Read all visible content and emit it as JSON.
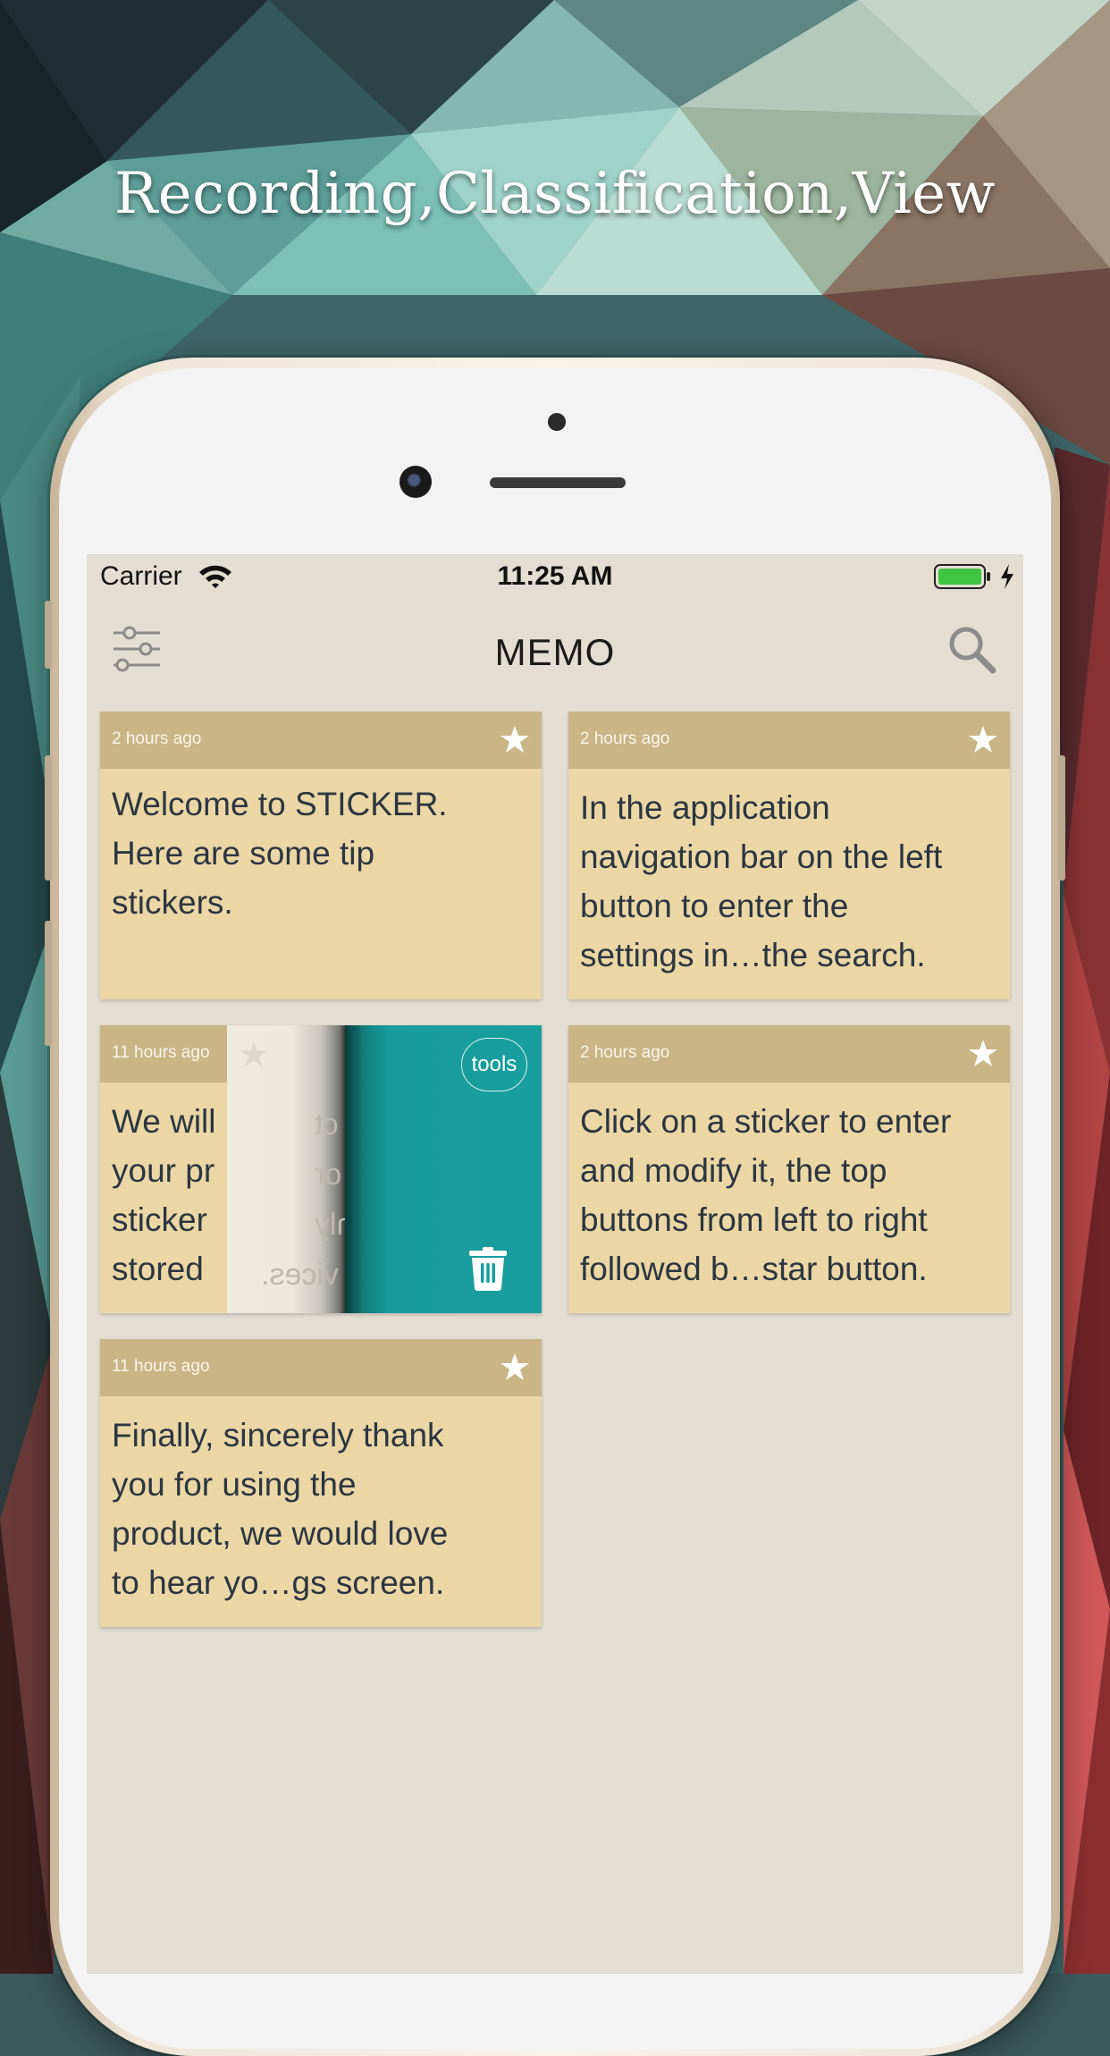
{
  "headline": "Recording,Classification,View",
  "status_bar": {
    "carrier": "Carrier",
    "time": "11:25 AM",
    "battery_color": "#3ec43e"
  },
  "navbar": {
    "title": "MEMO",
    "left_icon": "settings-sliders-icon",
    "right_icon": "search-icon"
  },
  "colors": {
    "screen_bg": "#e4ddd2",
    "card_body": "#ebd6a5",
    "card_header": "#c9b585",
    "tools_panel": "#189e9e",
    "text": "#2d3540"
  },
  "cards": [
    {
      "time": "2 hours ago",
      "lines": [
        "Welcome to STICKER.",
        "Here are some tip",
        "stickers."
      ]
    },
    {
      "time": "2 hours ago",
      "lines": [
        "In the application",
        "navigation bar on the left",
        "button to enter the",
        "settings in…the search."
      ]
    },
    {
      "time": "11 hours ago",
      "lines": [
        "We will",
        "your pr",
        "sticker",
        "stored"
      ],
      "swipe_tools_label": "tools",
      "swipe_delete_icon": "trash-icon",
      "mirrored_fragments": [
        "ct",
        "or",
        "nly",
        "vices."
      ]
    },
    {
      "time": "2 hours ago",
      "lines": [
        "Click on a sticker to enter",
        "and modify it, the top",
        "buttons from left to right",
        "followed b…star button."
      ]
    },
    {
      "time": "11 hours ago",
      "lines": [
        "Finally, sincerely thank",
        "you for using the",
        "product, we would love",
        "to hear yo…gs screen."
      ]
    }
  ]
}
